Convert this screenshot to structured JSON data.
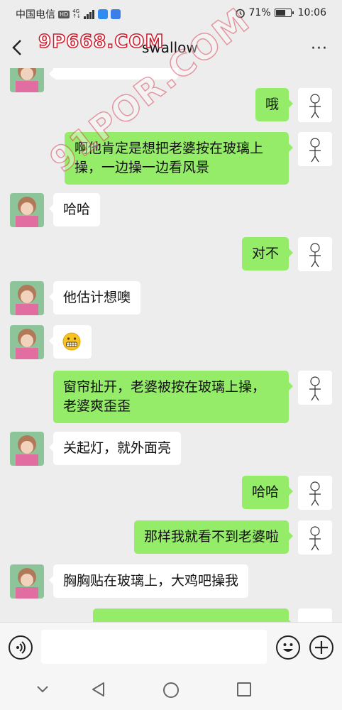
{
  "status_bar": {
    "carrier": "中国电信",
    "hd": "HD",
    "net_top": "4G",
    "net_bottom": "↑↓",
    "battery": "71%",
    "battery_level": 0.71,
    "time": "10:06"
  },
  "header": {
    "title": "swallow"
  },
  "watermark": {
    "line1": "9P668.COM",
    "line2": "91POR.COM"
  },
  "messages": [
    {
      "side": "out",
      "text": "哦"
    },
    {
      "side": "out",
      "lines": [
        "啊他肯定是想把老婆按在玻璃上",
        "操，一边操一边看风景"
      ]
    },
    {
      "side": "in",
      "text": "哈哈"
    },
    {
      "side": "out",
      "text": "对不"
    },
    {
      "side": "in",
      "text": "他估计想噢"
    },
    {
      "side": "in",
      "emoji": "grimacing-face"
    },
    {
      "side": "out",
      "lines": [
        "窗帘扯开，老婆被按在玻璃上操，",
        "老婆爽歪歪"
      ]
    },
    {
      "side": "in",
      "text": "关起灯，就外面亮"
    },
    {
      "side": "out",
      "text": "哈哈"
    },
    {
      "side": "out",
      "text": "那样我就看不到老婆啦"
    },
    {
      "side": "in",
      "text": "胸胸贴在玻璃上，大鸡吧操我"
    }
  ],
  "colors": {
    "background": "#ededed",
    "outgoing_bubble": "#95ec69",
    "incoming_bubble": "#ffffff",
    "watermark": "#d21a2c"
  }
}
